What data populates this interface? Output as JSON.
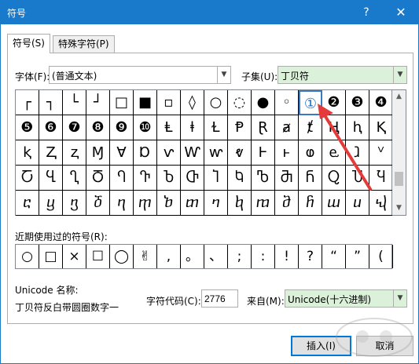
{
  "window": {
    "title": "符号",
    "help": "?",
    "close": "✕"
  },
  "tabs": [
    {
      "label": "符号(S)",
      "active": true
    },
    {
      "label": "特殊字符(P)",
      "active": false
    }
  ],
  "font": {
    "label": "字体(F):",
    "value": "(普通文本)"
  },
  "subset": {
    "label": "子集(U):",
    "value": "丁贝符"
  },
  "grid": {
    "rows": [
      [
        "┌",
        "┐",
        "└",
        "┘",
        "□",
        "■",
        "▫",
        "◊",
        "○",
        "◌",
        "●",
        "◦",
        "①",
        "❷",
        "❸",
        "❹"
      ],
      [
        "❺",
        "❻",
        "❼",
        "❽",
        "❾",
        "❿",
        "Ⱡ",
        "ⱡ",
        "Ɫ",
        "Ᵽ",
        "Ɽ",
        "ⱥ",
        "ⱦ",
        "Ⱨ",
        "ⱨ",
        "Ⱪ"
      ],
      [
        "ⱪ",
        "Ⱬ",
        "ⱬ",
        "Ɱ",
        "Ɐ",
        "Ɒ",
        "ⱱ",
        "Ⱳ",
        "ⱳ",
        "ⱴ",
        "Ⱶ",
        "ⱶ",
        "ⱷ",
        "ⱸ",
        "ⱹ",
        "ⱽ"
      ],
      [
        "Ⴀ",
        "Ⴁ",
        "Ⴂ",
        "Ⴃ",
        "Ⴄ",
        "Ⴅ",
        "Ⴆ",
        "Ⴇ",
        "Ⴈ",
        "Ⴉ",
        "Ⴊ",
        "Ⴋ",
        "Ⴌ",
        "Ⴍ",
        "Ⴎ",
        "Ⴏ"
      ],
      [
        "ⴀ",
        "ⴁ",
        "ⴂ",
        "ⴃ",
        "ⴄ",
        "ⴅ",
        "ⴆ",
        "ⴇ",
        "ⴈ",
        "ⴉ",
        "ⴊ",
        "ⴋ",
        "ⴌ",
        "ⴍ",
        "ⴎ",
        "ⴏ"
      ]
    ],
    "selected_row": 0,
    "selected_col": 12
  },
  "recent": {
    "label": "近期使用过的符号(R):",
    "items": [
      "○",
      "□",
      "×",
      "☐",
      "◯",
      "✌",
      ",",
      "。",
      "、",
      ";",
      ":",
      "!",
      "?",
      "“",
      "”",
      "("
    ]
  },
  "unicode_name": {
    "label": "Unicode 名称:",
    "value": "丁贝符反白带圆圈数字一"
  },
  "char_code": {
    "label": "字符代码(C):",
    "value": "2776"
  },
  "from": {
    "label": "来自(M):",
    "value": "Unicode(十六进制)"
  },
  "buttons": {
    "insert": "插入(I)",
    "cancel": "取消"
  },
  "colors": {
    "titlebar": "#1979ca",
    "subset_bg": "#dcf1d9",
    "arrow": "#e53a3a"
  }
}
